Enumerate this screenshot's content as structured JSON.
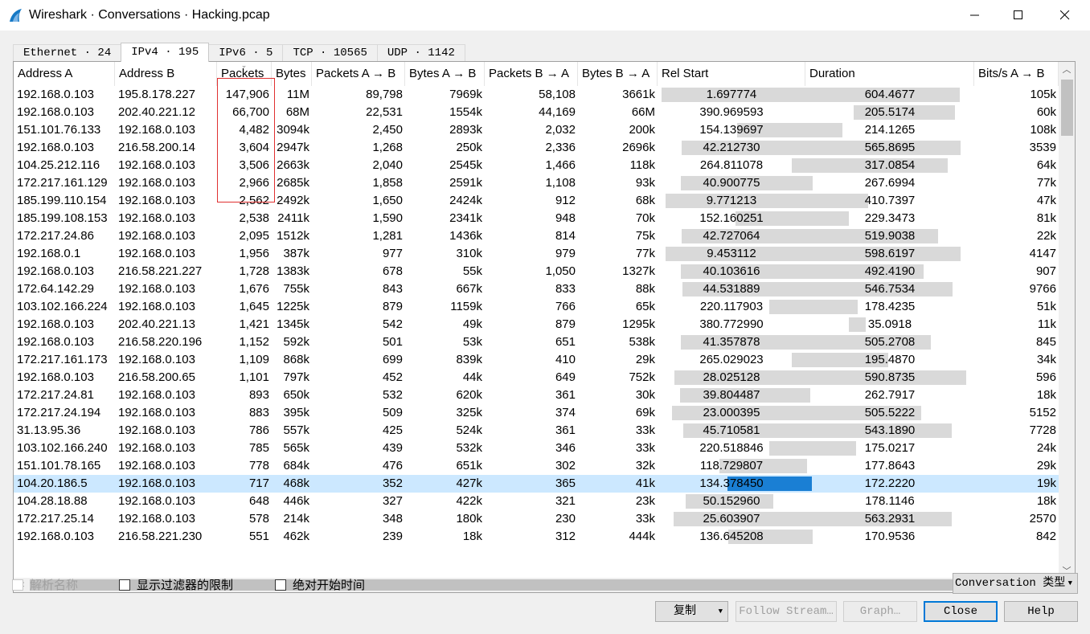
{
  "window": {
    "title": "Wireshark · Conversations · Hacking.pcap"
  },
  "tabs": [
    {
      "label": "Ethernet · 24"
    },
    {
      "label": "IPv4 · 195"
    },
    {
      "label": "IPv6 · 5"
    },
    {
      "label": "TCP · 10565"
    },
    {
      "label": "UDP · 1142"
    }
  ],
  "columns": [
    "Address A",
    "Address B",
    "Packets",
    "Bytes",
    "Packets A → B",
    "Bytes A → B",
    "Packets B → A",
    "Bytes B → A",
    "Rel Start",
    "Duration",
    "Bits/s A → B"
  ],
  "sort_column": "Packets",
  "rows": [
    [
      "192.168.0.103",
      "195.8.178.227",
      "147,906",
      "11M",
      "89,798",
      "7969k",
      "58,108",
      "3661k",
      "1.697774",
      "604.4677",
      "105k"
    ],
    [
      "192.168.0.103",
      "202.40.221.12",
      "66,700",
      "68M",
      "22,531",
      "1554k",
      "44,169",
      "66M",
      "390.969593",
      "205.5174",
      "60k"
    ],
    [
      "151.101.76.133",
      "192.168.0.103",
      "4,482",
      "3094k",
      "2,450",
      "2893k",
      "2,032",
      "200k",
      "154.139697",
      "214.1265",
      "108k"
    ],
    [
      "192.168.0.103",
      "216.58.200.14",
      "3,604",
      "2947k",
      "1,268",
      "250k",
      "2,336",
      "2696k",
      "42.212730",
      "565.8695",
      "3539"
    ],
    [
      "104.25.212.116",
      "192.168.0.103",
      "3,506",
      "2663k",
      "2,040",
      "2545k",
      "1,466",
      "118k",
      "264.811078",
      "317.0854",
      "64k"
    ],
    [
      "172.217.161.129",
      "192.168.0.103",
      "2,966",
      "2685k",
      "1,858",
      "2591k",
      "1,108",
      "93k",
      "40.900775",
      "267.6994",
      "77k"
    ],
    [
      "185.199.110.154",
      "192.168.0.103",
      "2,562",
      "2492k",
      "1,650",
      "2424k",
      "912",
      "68k",
      "9.771213",
      "410.7397",
      "47k"
    ],
    [
      "185.199.108.153",
      "192.168.0.103",
      "2,538",
      "2411k",
      "1,590",
      "2341k",
      "948",
      "70k",
      "152.160251",
      "229.3473",
      "81k"
    ],
    [
      "172.217.24.86",
      "192.168.0.103",
      "2,095",
      "1512k",
      "1,281",
      "1436k",
      "814",
      "75k",
      "42.727064",
      "519.9038",
      "22k"
    ],
    [
      "192.168.0.1",
      "192.168.0.103",
      "1,956",
      "387k",
      "977",
      "310k",
      "979",
      "77k",
      "9.453112",
      "598.6197",
      "4147"
    ],
    [
      "192.168.0.103",
      "216.58.221.227",
      "1,728",
      "1383k",
      "678",
      "55k",
      "1,050",
      "1327k",
      "40.103616",
      "492.4190",
      "907"
    ],
    [
      "172.64.142.29",
      "192.168.0.103",
      "1,676",
      "755k",
      "843",
      "667k",
      "833",
      "88k",
      "44.531889",
      "546.7534",
      "9766"
    ],
    [
      "103.102.166.224",
      "192.168.0.103",
      "1,645",
      "1225k",
      "879",
      "1159k",
      "766",
      "65k",
      "220.117903",
      "178.4235",
      "51k"
    ],
    [
      "192.168.0.103",
      "202.40.221.13",
      "1,421",
      "1345k",
      "542",
      "49k",
      "879",
      "1295k",
      "380.772990",
      "35.0918",
      "11k"
    ],
    [
      "192.168.0.103",
      "216.58.220.196",
      "1,152",
      "592k",
      "501",
      "53k",
      "651",
      "538k",
      "41.357878",
      "505.2708",
      "845"
    ],
    [
      "172.217.161.173",
      "192.168.0.103",
      "1,109",
      "868k",
      "699",
      "839k",
      "410",
      "29k",
      "265.029023",
      "195.4870",
      "34k"
    ],
    [
      "192.168.0.103",
      "216.58.200.65",
      "1,101",
      "797k",
      "452",
      "44k",
      "649",
      "752k",
      "28.025128",
      "590.8735",
      "596"
    ],
    [
      "172.217.24.81",
      "192.168.0.103",
      "893",
      "650k",
      "532",
      "620k",
      "361",
      "30k",
      "39.804487",
      "262.7917",
      "18k"
    ],
    [
      "172.217.24.194",
      "192.168.0.103",
      "883",
      "395k",
      "509",
      "325k",
      "374",
      "69k",
      "23.000395",
      "505.5222",
      "5152"
    ],
    [
      "31.13.95.36",
      "192.168.0.103",
      "786",
      "557k",
      "425",
      "524k",
      "361",
      "33k",
      "45.710581",
      "543.1890",
      "7728"
    ],
    [
      "103.102.166.240",
      "192.168.0.103",
      "785",
      "565k",
      "439",
      "532k",
      "346",
      "33k",
      "220.518846",
      "175.0217",
      "24k"
    ],
    [
      "151.101.78.165",
      "192.168.0.103",
      "778",
      "684k",
      "476",
      "651k",
      "302",
      "32k",
      "118.729807",
      "177.8643",
      "29k"
    ],
    [
      "104.20.186.5",
      "192.168.0.103",
      "717",
      "468k",
      "352",
      "427k",
      "365",
      "41k",
      "134.378450",
      "172.2220",
      "19k"
    ],
    [
      "104.28.18.88",
      "192.168.0.103",
      "648",
      "446k",
      "327",
      "422k",
      "321",
      "23k",
      "50.152960",
      "178.1146",
      "18k"
    ],
    [
      "172.217.25.14",
      "192.168.0.103",
      "578",
      "214k",
      "348",
      "180k",
      "230",
      "33k",
      "25.603907",
      "563.2931",
      "2570"
    ],
    [
      "192.168.0.103",
      "216.58.221.230",
      "551",
      "462k",
      "239",
      "18k",
      "312",
      "444k",
      "136.645208",
      "170.9536",
      "842"
    ]
  ],
  "selected_row_index": 22,
  "options": {
    "resolve_names": "解析名称",
    "limit_to_filter": "显示过滤器的限制",
    "absolute_start": "绝对开始时间"
  },
  "conversation_type_button": "Conversation 类型",
  "buttons": {
    "copy": "复制",
    "follow_stream": "Follow Stream…",
    "graph": "Graph…",
    "close": "Close",
    "help": "Help"
  },
  "colors": {
    "selection": "#cce8ff",
    "bar": "#d9d9d9",
    "bar_selected": "#1a7fd4",
    "highlight_box": "#e03030"
  }
}
